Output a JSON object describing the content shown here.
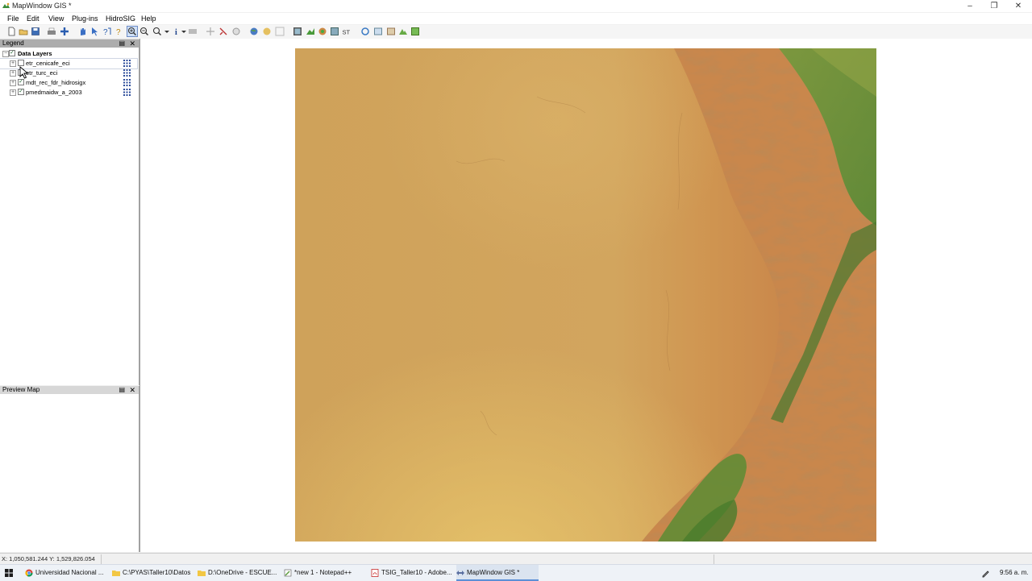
{
  "window": {
    "title": "MapWindow GIS *"
  },
  "menu": [
    "File",
    "Edit",
    "View",
    "Plug-ins",
    "HidroSIG",
    "Help"
  ],
  "toolbar_icons": [
    "new-icon",
    "open-icon",
    "save-icon",
    "print-icon",
    "add-layer-icon",
    "pan-icon",
    "select-icon",
    "query-icon",
    "help-icon",
    "zoom-in-icon",
    "zoom-out-icon",
    "zoom-extent-icon",
    "identify-icon",
    "measure-icon",
    "move-icon",
    "pointer-tool-icon",
    "label-icon",
    "globe-icon",
    "shapefile-icon",
    "grid-icon",
    "raster-icon",
    "hydro-icon",
    "layer-tool-icon",
    "st-tool-icon",
    "refresh-icon",
    "chart-icon",
    "stream-icon",
    "terrain-icon",
    "flow-icon"
  ],
  "legend": {
    "title": "Legend",
    "group": "Data Layers",
    "layers": [
      {
        "name": "etr_cenicafe_eci",
        "checked": false
      },
      {
        "name": "etr_turc_eci",
        "checked": false
      },
      {
        "name": "mdt_rec_fdr_hidrosigx",
        "checked": true
      },
      {
        "name": "pmedmaidw_a_2003",
        "checked": true
      }
    ]
  },
  "preview": {
    "title": "Preview Map"
  },
  "status": {
    "coords": "X: 1,050,581.244 Y: 1,529,826.054"
  },
  "taskbar": {
    "items": [
      {
        "label": "Universidad Nacional ...",
        "icon": "chrome-icon"
      },
      {
        "label": "C:\\PYAS\\Taller10\\Datos",
        "icon": "folder-icon"
      },
      {
        "label": "D:\\OneDrive - ESCUE...",
        "icon": "folder-icon"
      },
      {
        "label": "*new 1 - Notepad++",
        "icon": "notepad-icon"
      },
      {
        "label": "TSIG_Taller10 - Adobe...",
        "icon": "pdf-icon"
      },
      {
        "label": "MapWindow GIS *",
        "icon": "mapwindow-icon"
      }
    ],
    "clock": "9:56 a. m."
  },
  "colors": {
    "accent": "#3a6fc4",
    "terrain_low": "#d2a25c",
    "terrain_high": "#5e9436"
  }
}
